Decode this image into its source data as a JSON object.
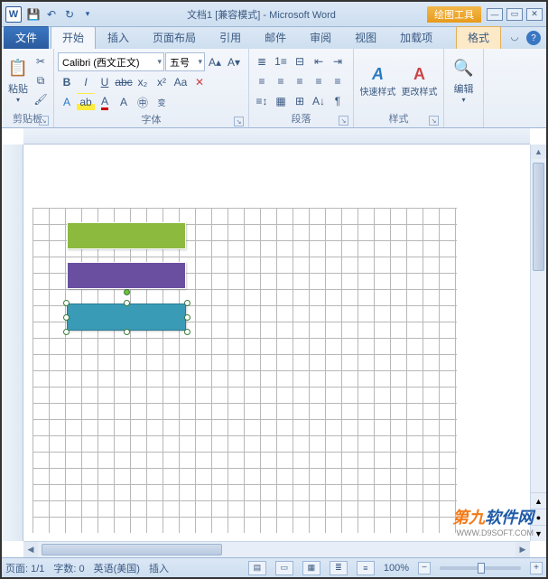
{
  "title": {
    "doc": "文档1",
    "mode": "[兼容模式]",
    "app": "Microsoft Word",
    "context_tab_group": "绘图工具"
  },
  "qat": {
    "save": "save-icon",
    "undo": "undo-icon",
    "redo": "redo-icon"
  },
  "tabs": {
    "file": "文件",
    "items": [
      "开始",
      "插入",
      "页面布局",
      "引用",
      "邮件",
      "审阅",
      "视图",
      "加载项"
    ],
    "context": "格式",
    "active_index": 0
  },
  "ribbon": {
    "clipboard": {
      "paste": "粘贴",
      "label": "剪贴板"
    },
    "font": {
      "name": "Calibri (西文正文)",
      "size": "五号",
      "label": "字体"
    },
    "paragraph": {
      "label": "段落"
    },
    "styles": {
      "quick": "快速样式",
      "change": "更改样式",
      "label": "样式"
    },
    "editing": {
      "label": "编辑"
    }
  },
  "shapes": {
    "green": {
      "fill": "#8cba3f"
    },
    "purple": {
      "fill": "#6a4fa0"
    },
    "teal": {
      "fill": "#3a9bb7",
      "selected": true
    }
  },
  "status": {
    "page": "页面: 1/1",
    "words": "字数: 0",
    "lang": "英语(美国)",
    "mode": "插入",
    "zoom": "100%"
  },
  "watermark": {
    "a": "第九",
    "b": "软件网",
    "url": "WWW.D9SOFT.COM"
  }
}
